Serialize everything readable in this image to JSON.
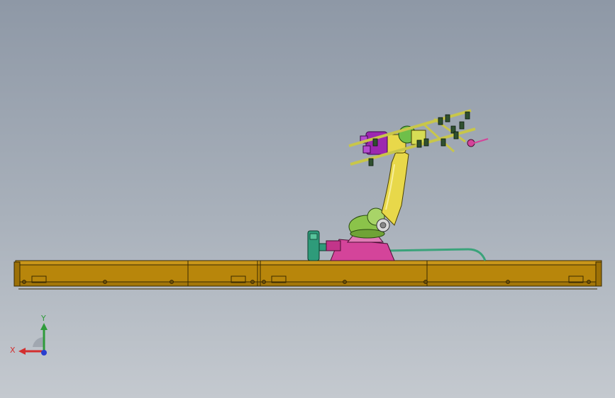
{
  "viewport": {
    "background_top": "#8e98a6",
    "background_bottom": "#c4c9cf"
  },
  "model": {
    "rail_color": "#b8860b",
    "base_color": "#d4449a",
    "arm_color": "#e8d84a",
    "joint_color": "#8bc34a",
    "gripper_color": "#9c27b0",
    "motor_color": "#2e9b7a",
    "cable_color": "#3aa37a"
  },
  "triad": {
    "x_label": "X",
    "y_label": "Y",
    "x_color": "#d32f2f",
    "y_color": "#2e9b3a",
    "z_color": "#2a3fcf"
  }
}
